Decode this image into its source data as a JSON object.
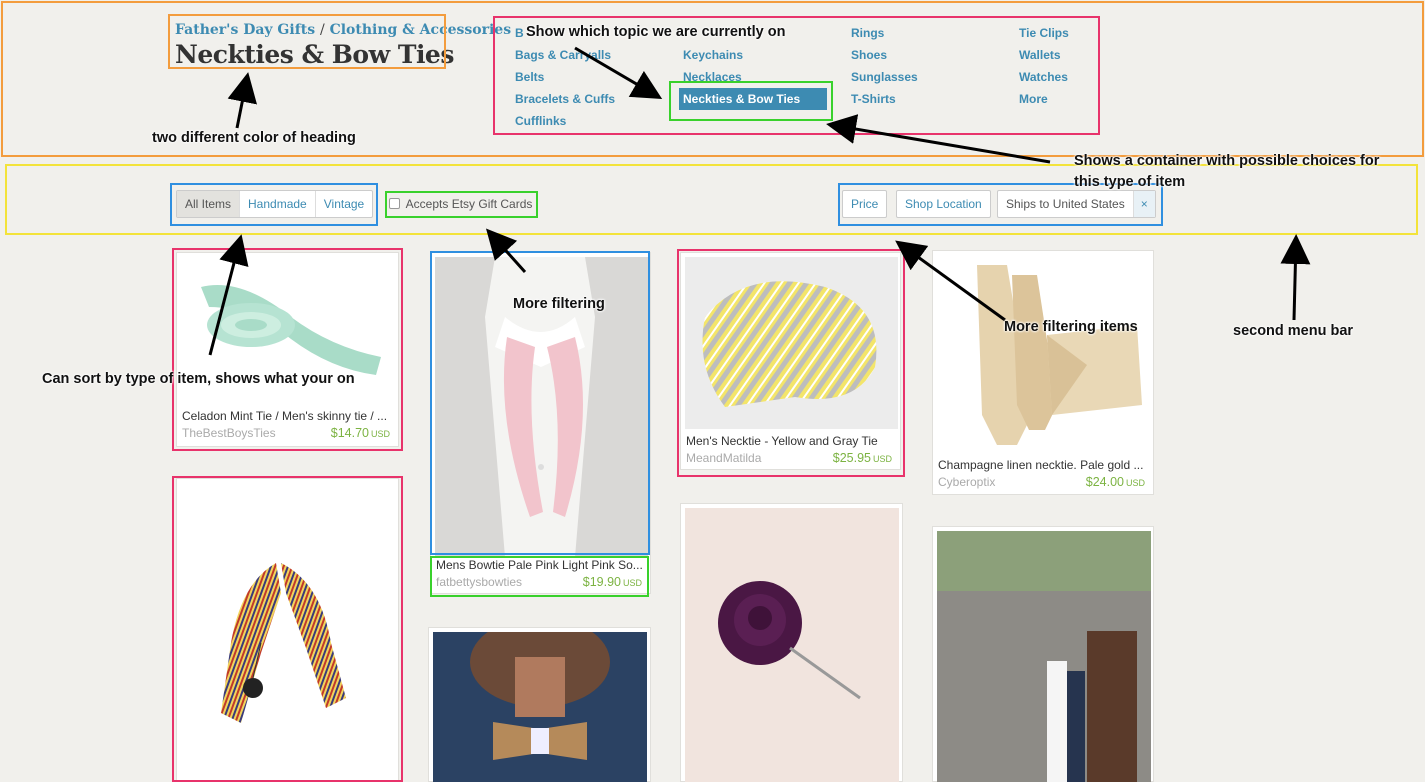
{
  "breadcrumb": {
    "parent1": "Father's Day Gifts",
    "separator": "/",
    "parent2": "Clothing & Accessories"
  },
  "page_title": "Neckties & Bow Ties",
  "categories": {
    "col1": [
      "B",
      "Bags & Carryalls",
      "Belts",
      "Bracelets & Cuffs",
      "Cufflinks"
    ],
    "col2": [
      "Keychains",
      "Necklaces",
      "Neckties & Bow Ties"
    ],
    "col3": [
      "Rings",
      "Shoes",
      "Sunglasses",
      "T-Shirts"
    ],
    "col4": [
      "Tie Clips",
      "Wallets",
      "Watches",
      "More"
    ],
    "active": "Neckties & Bow Ties"
  },
  "filters": {
    "item_types": [
      "All Items",
      "Handmade",
      "Vintage"
    ],
    "active_item_type": "All Items",
    "gift_cards_label": "Accepts Etsy Gift Cards",
    "price_label": "Price",
    "shop_location_label": "Shop Location",
    "ships_to_label": "Ships to United States",
    "clear_symbol": "×"
  },
  "listings": [
    {
      "title": "Celadon Mint Tie / Men's skinny tie / ...",
      "shop": "TheBestBoysTies",
      "price": "$14.70",
      "currency": "USD"
    },
    {
      "title": "Mens Bowtie Pale Pink Light Pink So...",
      "shop": "fatbettysbowties",
      "price": "$19.90",
      "currency": "USD"
    },
    {
      "title": "Men's Necktie - Yellow and Gray Tie",
      "shop": "MeandMatilda",
      "price": "$25.95",
      "currency": "USD"
    },
    {
      "title": "Champagne linen necktie. Pale gold ...",
      "shop": "Cyberoptix",
      "price": "$24.00",
      "currency": "USD"
    }
  ],
  "annotations": {
    "heading": "two different color of heading",
    "topic": "Show which topic we are currently on",
    "container_line1": "Shows a container with possible choices for",
    "container_line2": "this type of item",
    "sort": "Can sort by type of item, shows what your on",
    "more_filtering": "More filtering",
    "more_filtering_items": "More filtering items",
    "second_menu": "second menu bar"
  },
  "colors": {
    "orange_box": "#f39c3d",
    "pink_box": "#e8336b",
    "yellow_box": "#f3e33a",
    "blue_box": "#2f8fe0",
    "green_box": "#39d12c",
    "link": "#3d8bb2",
    "price": "#7cb342"
  },
  "icons": [
    "arrow-icon",
    "checkbox-icon",
    "close-icon"
  ]
}
